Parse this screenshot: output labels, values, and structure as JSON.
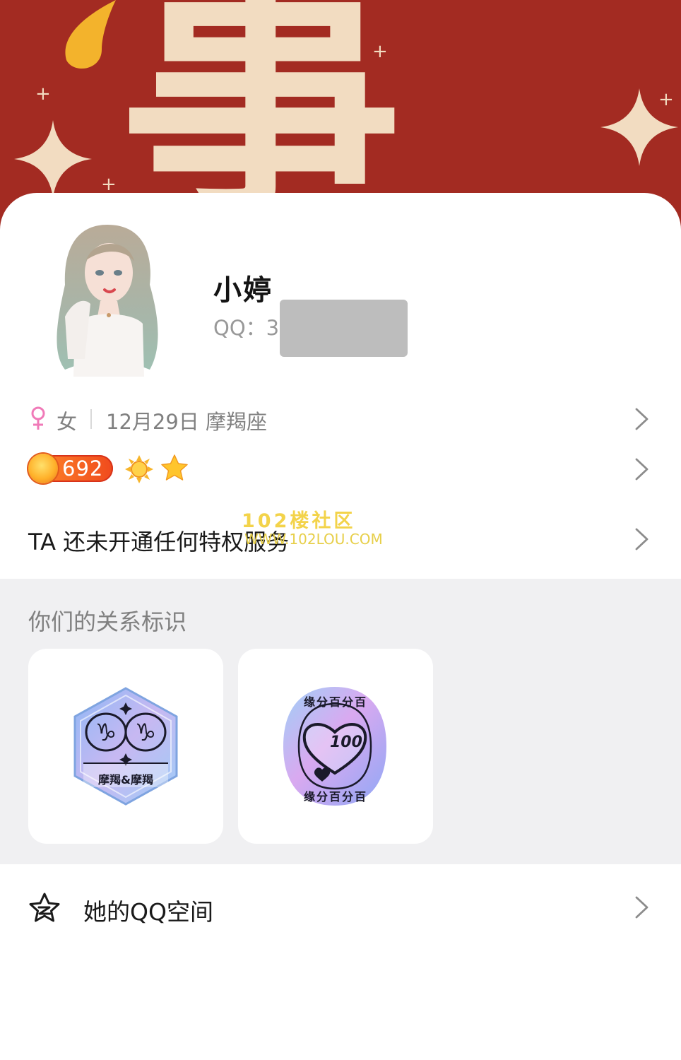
{
  "banner": {
    "glyph_text": "事成",
    "color_bg": "#a32b22",
    "color_glyph": "#f2dcc1"
  },
  "profile": {
    "name": "小婷",
    "qq_label": "QQ：3",
    "avatar_icon": "avatar-portrait"
  },
  "info": {
    "gender_symbol": "♀",
    "gender": "女",
    "birthday": "12月29日",
    "zodiac": "摩羯座"
  },
  "level": {
    "value": "692",
    "badges": [
      "sun-icon",
      "star-icon"
    ]
  },
  "privilege": {
    "text": "TA 还未开通任何特权服务"
  },
  "watermark": {
    "title": "102楼社区",
    "url": "WWW.102LOU.COM"
  },
  "relationship": {
    "title": "你们的关系标识",
    "badges": [
      {
        "label": "摩羯&摩羯",
        "icon": "capricorn-badge-icon"
      },
      {
        "label": "缘分百分百",
        "icon": "heart-100-badge-icon",
        "number": "100"
      }
    ]
  },
  "qzone": {
    "label": "她的QQ空间",
    "icon": "qzone-star-icon"
  }
}
